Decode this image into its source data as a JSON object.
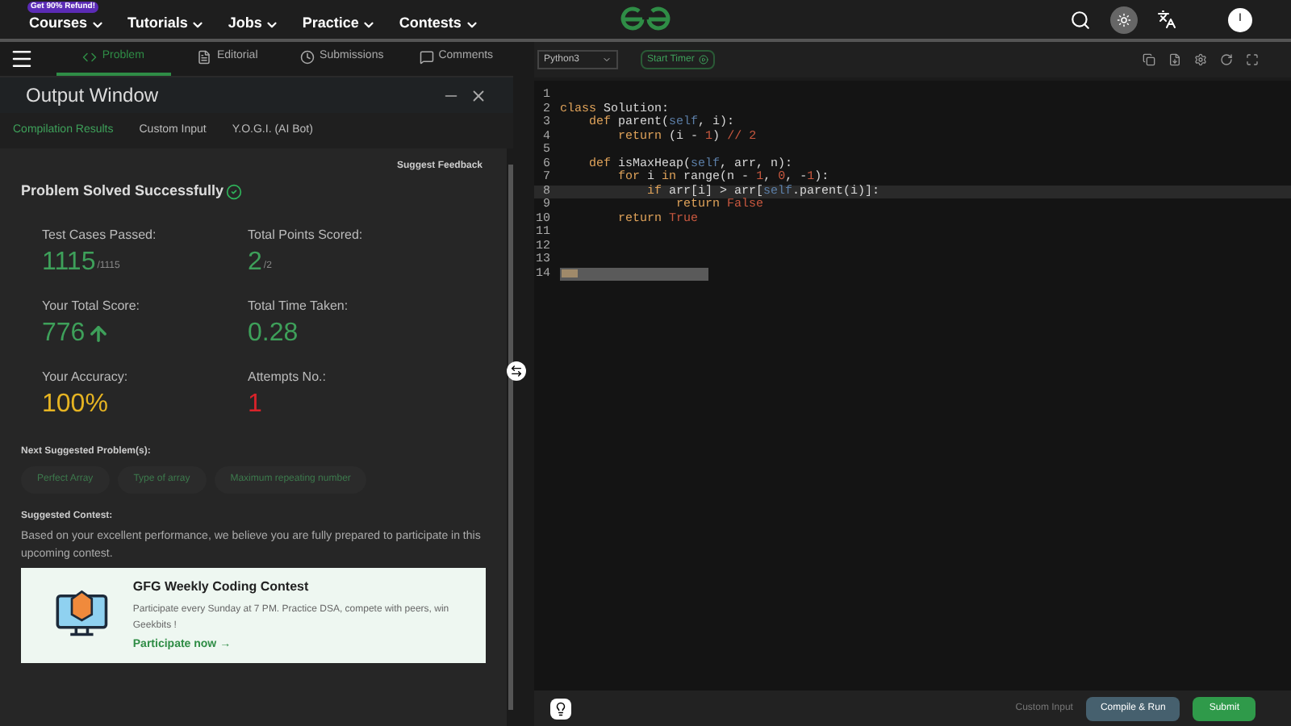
{
  "promo_badge": "Get 90% Refund!",
  "nav": [
    {
      "label": "Courses"
    },
    {
      "label": "Tutorials"
    },
    {
      "label": "Jobs"
    },
    {
      "label": "Practice"
    },
    {
      "label": "Contests"
    }
  ],
  "avatar_initial": "I",
  "problem_tabs": [
    {
      "label": "Problem",
      "selected": true
    },
    {
      "label": "Editorial",
      "selected": false
    },
    {
      "label": "Submissions",
      "selected": false
    },
    {
      "label": "Comments",
      "selected": false
    }
  ],
  "output_window": {
    "title": "Output Window",
    "tabs": [
      {
        "label": "Compilation Results",
        "selected": true
      },
      {
        "label": "Custom Input",
        "selected": false
      },
      {
        "label": "Y.O.G.I. (AI Bot)",
        "selected": false
      }
    ],
    "feedback_link": "Suggest Feedback",
    "status": "Problem Solved Successfully",
    "stats": [
      {
        "label": "Test Cases Passed:",
        "value": "1115",
        "suffix": "/1115",
        "color": "#3ea05a",
        "arrow": false
      },
      {
        "label": "Total Points Scored:",
        "value": "2",
        "suffix": "/2",
        "color": "#3ea05a",
        "arrow": false
      },
      {
        "label": "Your Total Score:",
        "value": "776",
        "color": "#3ea05a",
        "arrow": true
      },
      {
        "label": "Total Time Taken:",
        "value": "0.28",
        "color": "#3ea05a",
        "arrow": false
      },
      {
        "label": "Your Accuracy:",
        "value": "100%",
        "color": "#e6b422",
        "arrow": false
      },
      {
        "label": "Attempts No.:",
        "value": "1",
        "color": "#d8232a",
        "arrow": false
      }
    ],
    "next_heading": "Next Suggested Problem(s):",
    "suggestions": [
      "Perfect Array",
      "Type of array",
      "Maximum repeating number"
    ],
    "contest_heading": "Suggested Contest:",
    "contest_text": "Based on your excellent performance, we believe you are fully prepared to participate in this upcoming contest.",
    "contest_card": {
      "title": "GFG Weekly Coding Contest",
      "description": "Participate every Sunday at 7 PM. Practice DSA, compete with peers, win Geekbits !",
      "link": "Participate now →"
    }
  },
  "editor": {
    "language": "Python3",
    "timer_button": "Start Timer",
    "lines": [
      {
        "number": "1",
        "active": false,
        "suggestion": false
      },
      {
        "number": "2",
        "active": false,
        "suggestion": false,
        "segments": [
          {
            "text": "class",
            "kind": "kw"
          },
          {
            "text": " Solution:",
            "kind": "plain"
          }
        ]
      },
      {
        "number": "3",
        "active": false,
        "suggestion": false,
        "segments": [
          {
            "text": "    def",
            "kind": "kw"
          },
          {
            "text": " parent(",
            "kind": "plain"
          },
          {
            "text": "self",
            "kind": "self"
          },
          {
            "text": ", i):",
            "kind": "plain"
          }
        ]
      },
      {
        "number": "4",
        "active": false,
        "suggestion": false,
        "segments": [
          {
            "text": "        return",
            "kind": "kw"
          },
          {
            "text": " (i - ",
            "kind": "plain"
          },
          {
            "text": "1",
            "kind": "num"
          },
          {
            "text": ") ",
            "kind": "plain"
          },
          {
            "text": "// 2",
            "kind": "num"
          }
        ]
      },
      {
        "number": "5",
        "active": false,
        "suggestion": false
      },
      {
        "number": "6",
        "active": false,
        "suggestion": false,
        "segments": [
          {
            "text": "    def",
            "kind": "kw"
          },
          {
            "text": " isMaxHeap(",
            "kind": "plain"
          },
          {
            "text": "self",
            "kind": "self"
          },
          {
            "text": ", arr, n):",
            "kind": "plain"
          }
        ]
      },
      {
        "number": "7",
        "active": false,
        "suggestion": false,
        "segments": [
          {
            "text": "        for",
            "kind": "kw"
          },
          {
            "text": " i ",
            "kind": "plain"
          },
          {
            "text": "in",
            "kind": "kw"
          },
          {
            "text": " range(n - ",
            "kind": "plain"
          },
          {
            "text": "1",
            "kind": "num"
          },
          {
            "text": ", ",
            "kind": "plain"
          },
          {
            "text": "0",
            "kind": "num"
          },
          {
            "text": ", -",
            "kind": "plain"
          },
          {
            "text": "1",
            "kind": "num"
          },
          {
            "text": "):",
            "kind": "plain"
          }
        ]
      },
      {
        "number": "8",
        "active": true,
        "suggestion": false,
        "segments": [
          {
            "text": "            if",
            "kind": "kw"
          },
          {
            "text": " arr[i] > arr[",
            "kind": "plain"
          },
          {
            "text": "self",
            "kind": "self"
          },
          {
            "text": ".parent(i)]:",
            "kind": "plain"
          }
        ]
      },
      {
        "number": "9",
        "active": false,
        "suggestion": false,
        "segments": [
          {
            "text": "                return ",
            "kind": "kw"
          },
          {
            "text": "False",
            "kind": "num"
          }
        ]
      },
      {
        "number": "10",
        "active": false,
        "suggestion": false,
        "segments": [
          {
            "text": "        return ",
            "kind": "kw"
          },
          {
            "text": "True",
            "kind": "num"
          }
        ]
      },
      {
        "number": "11",
        "active": false,
        "suggestion": false
      },
      {
        "number": "12",
        "active": false,
        "suggestion": false
      },
      {
        "number": "13",
        "active": false,
        "suggestion": false
      },
      {
        "number": "14",
        "active": false,
        "suggestion": true
      }
    ]
  },
  "footer": {
    "custom_input": "Custom Input",
    "compile_button": "Compile & Run",
    "submit_button": "Submit"
  }
}
